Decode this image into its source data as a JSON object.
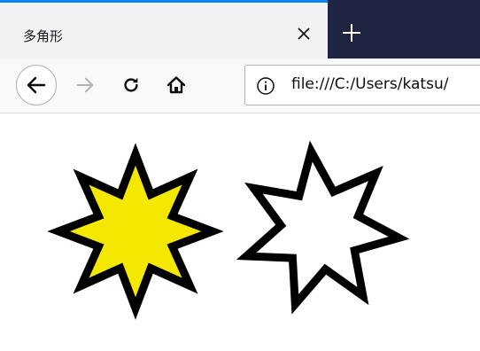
{
  "tab": {
    "title": "多角形",
    "close_icon": "close-icon",
    "new_tab_icon": "plus-icon"
  },
  "navbar": {
    "back_icon": "back-arrow-icon",
    "forward_icon": "forward-arrow-icon",
    "reload_icon": "reload-icon",
    "home_icon": "home-icon",
    "info_icon": "info-icon",
    "url": "file:///C:/Users/katsu/"
  },
  "colors": {
    "tab_strip": "#1f2442",
    "tab_accent": "#0a84ff",
    "star_fill": "#f5e800",
    "star_stroke": "#000000"
  },
  "stars": [
    {
      "name": "filled-star",
      "points": 8,
      "fill": "#f5e800"
    },
    {
      "name": "outline-star",
      "points": 7,
      "fill": "#ffffff"
    }
  ]
}
